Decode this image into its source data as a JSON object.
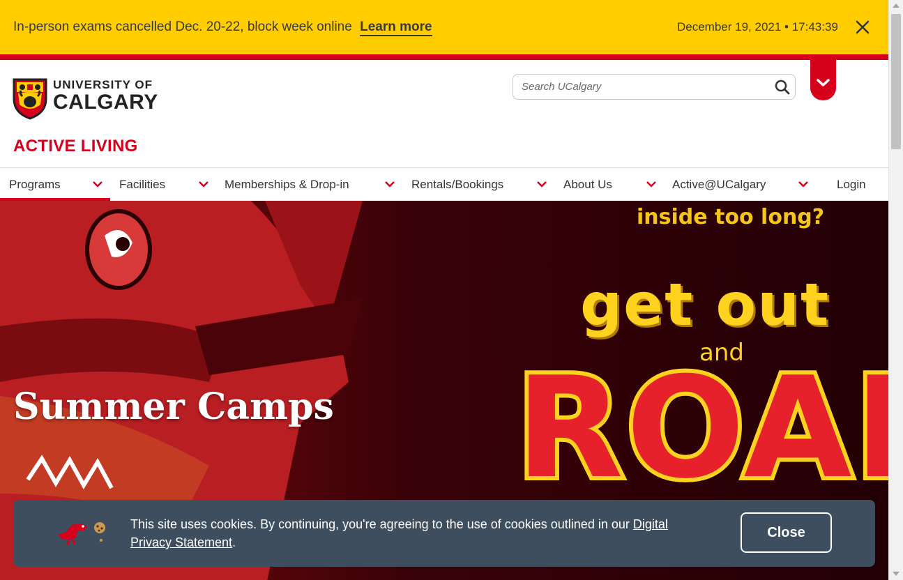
{
  "alert": {
    "message": "In-person exams cancelled Dec. 20-22, block week online",
    "link_label": "Learn more",
    "datetime": "December 19, 2021 • 17:43:39"
  },
  "header": {
    "logo_line1": "UNIVERSITY OF",
    "logo_line2": "CALGARY",
    "site_title": "ACTIVE LIVING",
    "search_placeholder": "Search UCalgary"
  },
  "nav": {
    "items": [
      {
        "label": "Programs"
      },
      {
        "label": "Facilities"
      },
      {
        "label": "Memberships & Drop-in"
      },
      {
        "label": "Rentals/Bookings"
      },
      {
        "label": "About Us"
      },
      {
        "label": "Active@UCalgary"
      },
      {
        "label": "Login"
      }
    ]
  },
  "hero": {
    "title": "Summer Camps",
    "poster_line1": "inside too long?",
    "poster_line2": "get out",
    "poster_line3": "and",
    "poster_line4": "ROAR"
  },
  "cookie": {
    "text_before": "This site uses cookies. By continuing, you're agreeing to the use of cookies outlined in our ",
    "link_label": "Digital Privacy Statement",
    "text_after": ".",
    "close_label": "Close"
  },
  "colors": {
    "brand_red": "#d6001c",
    "brand_yellow": "#ffcd00",
    "cookie_bg": "#3e4e5e"
  }
}
